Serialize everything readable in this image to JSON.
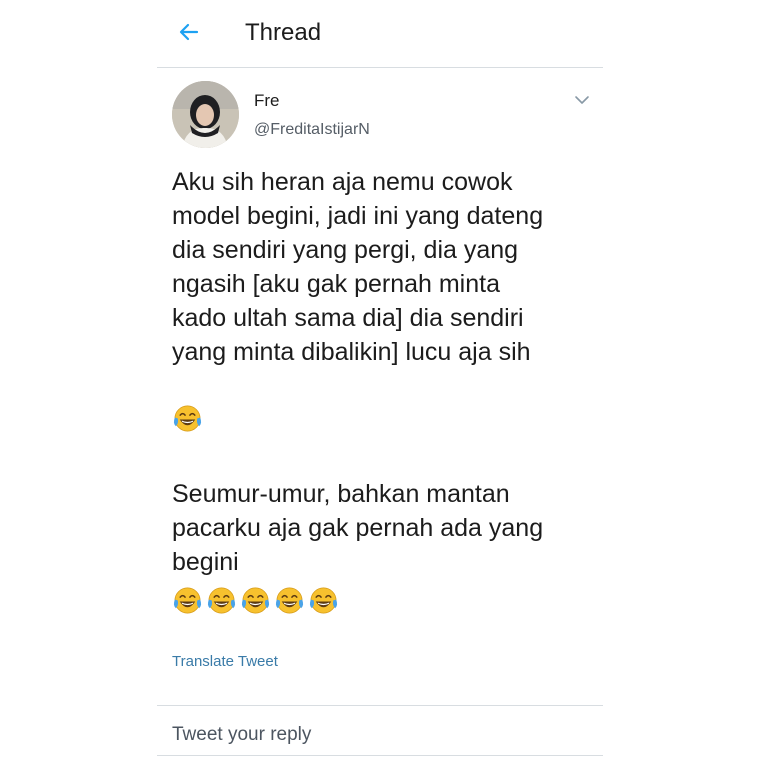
{
  "header": {
    "back_icon": "arrow-left-icon",
    "title": "Thread",
    "accent": "#1da1f2"
  },
  "tweet": {
    "display_name": "Fre",
    "handle": "@FreditaIstijarN",
    "avatar_icon": "avatar",
    "menu_icon": "chevron-down-icon",
    "paragraphs": [
      "Aku sih heran aja nemu cowok\nmodel begini, jadi ini yang dateng\ndia sendiri yang pergi, dia yang\nngasih [aku gak pernah minta\nkado ultah sama dia] dia sendiri\nyang minta dibalikin] lucu aja sih",
      "Seumur-umur, bahkan mantan\npacarku aja gak pernah ada yang\nbegini"
    ],
    "emoji_name": "face-with-tears-of-joy",
    "emoji_count_line": 5,
    "translate_label": "Translate Tweet",
    "link_color": "#3a7ba8"
  },
  "reply": {
    "placeholder": "Tweet your reply"
  }
}
